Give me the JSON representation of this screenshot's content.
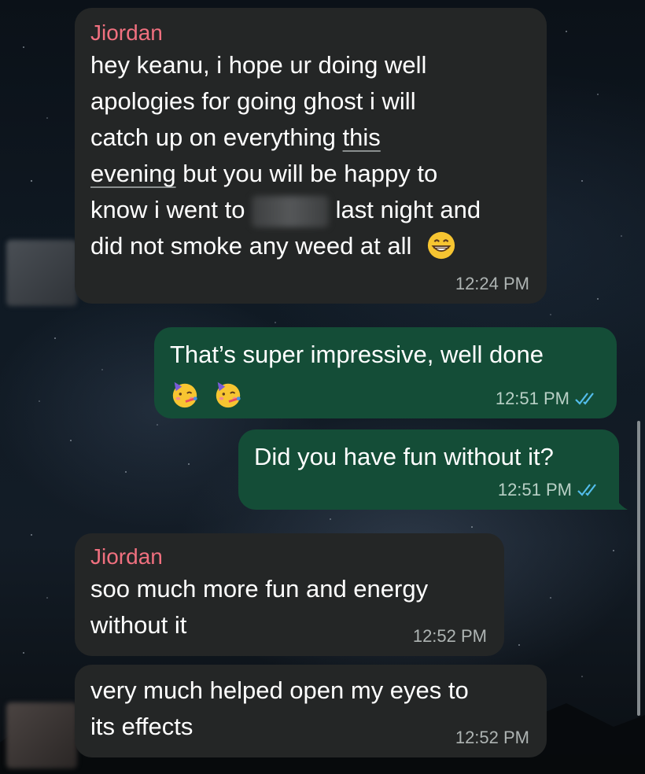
{
  "messages": [
    {
      "sender": "Jiordan",
      "time": "12:24 PM",
      "lines": {
        "l1": "hey keanu, i hope ur doing well",
        "l2": "apologies for going ghost i will",
        "l3a": "catch up on everything ",
        "l3b": "this",
        "l4a": "evening",
        "l4b": " but you will be happy to",
        "l5a": "know i went to ",
        "l5b": "last night and",
        "l6": "did not smoke any weed at all"
      }
    },
    {
      "text": "That’s super impressive, well done",
      "time": "12:51 PM",
      "status": "read"
    },
    {
      "text": "Did you have fun without it?",
      "time": "12:51 PM",
      "status": "read"
    },
    {
      "sender": "Jiordan",
      "text_l1": "soo much more fun and energy",
      "text_l2": "without it",
      "time": "12:52 PM"
    },
    {
      "text_l1": "very much helped open my eyes to",
      "text_l2": "its effects",
      "time": "12:52 PM"
    }
  ],
  "icons": {
    "read_receipt": "double-check-icon",
    "emoji_grin": "grinning-face-emoji",
    "emoji_party": "partying-face-emoji"
  },
  "colors": {
    "incoming_bubble": "#242626",
    "outgoing_bubble": "#144d37",
    "sender_name": "#f0707f",
    "read_ticks": "#53bdeb"
  }
}
